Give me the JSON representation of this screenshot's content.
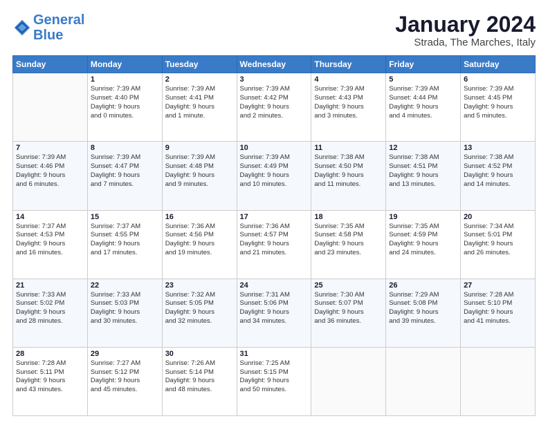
{
  "header": {
    "logo_line1": "General",
    "logo_line2": "Blue",
    "month": "January 2024",
    "location": "Strada, The Marches, Italy"
  },
  "weekdays": [
    "Sunday",
    "Monday",
    "Tuesday",
    "Wednesday",
    "Thursday",
    "Friday",
    "Saturday"
  ],
  "weeks": [
    [
      {
        "day": "",
        "info": ""
      },
      {
        "day": "1",
        "info": "Sunrise: 7:39 AM\nSunset: 4:40 PM\nDaylight: 9 hours\nand 0 minutes."
      },
      {
        "day": "2",
        "info": "Sunrise: 7:39 AM\nSunset: 4:41 PM\nDaylight: 9 hours\nand 1 minute."
      },
      {
        "day": "3",
        "info": "Sunrise: 7:39 AM\nSunset: 4:42 PM\nDaylight: 9 hours\nand 2 minutes."
      },
      {
        "day": "4",
        "info": "Sunrise: 7:39 AM\nSunset: 4:43 PM\nDaylight: 9 hours\nand 3 minutes."
      },
      {
        "day": "5",
        "info": "Sunrise: 7:39 AM\nSunset: 4:44 PM\nDaylight: 9 hours\nand 4 minutes."
      },
      {
        "day": "6",
        "info": "Sunrise: 7:39 AM\nSunset: 4:45 PM\nDaylight: 9 hours\nand 5 minutes."
      }
    ],
    [
      {
        "day": "7",
        "info": "Sunrise: 7:39 AM\nSunset: 4:46 PM\nDaylight: 9 hours\nand 6 minutes."
      },
      {
        "day": "8",
        "info": "Sunrise: 7:39 AM\nSunset: 4:47 PM\nDaylight: 9 hours\nand 7 minutes."
      },
      {
        "day": "9",
        "info": "Sunrise: 7:39 AM\nSunset: 4:48 PM\nDaylight: 9 hours\nand 9 minutes."
      },
      {
        "day": "10",
        "info": "Sunrise: 7:39 AM\nSunset: 4:49 PM\nDaylight: 9 hours\nand 10 minutes."
      },
      {
        "day": "11",
        "info": "Sunrise: 7:38 AM\nSunset: 4:50 PM\nDaylight: 9 hours\nand 11 minutes."
      },
      {
        "day": "12",
        "info": "Sunrise: 7:38 AM\nSunset: 4:51 PM\nDaylight: 9 hours\nand 13 minutes."
      },
      {
        "day": "13",
        "info": "Sunrise: 7:38 AM\nSunset: 4:52 PM\nDaylight: 9 hours\nand 14 minutes."
      }
    ],
    [
      {
        "day": "14",
        "info": "Sunrise: 7:37 AM\nSunset: 4:53 PM\nDaylight: 9 hours\nand 16 minutes."
      },
      {
        "day": "15",
        "info": "Sunrise: 7:37 AM\nSunset: 4:55 PM\nDaylight: 9 hours\nand 17 minutes."
      },
      {
        "day": "16",
        "info": "Sunrise: 7:36 AM\nSunset: 4:56 PM\nDaylight: 9 hours\nand 19 minutes."
      },
      {
        "day": "17",
        "info": "Sunrise: 7:36 AM\nSunset: 4:57 PM\nDaylight: 9 hours\nand 21 minutes."
      },
      {
        "day": "18",
        "info": "Sunrise: 7:35 AM\nSunset: 4:58 PM\nDaylight: 9 hours\nand 23 minutes."
      },
      {
        "day": "19",
        "info": "Sunrise: 7:35 AM\nSunset: 4:59 PM\nDaylight: 9 hours\nand 24 minutes."
      },
      {
        "day": "20",
        "info": "Sunrise: 7:34 AM\nSunset: 5:01 PM\nDaylight: 9 hours\nand 26 minutes."
      }
    ],
    [
      {
        "day": "21",
        "info": "Sunrise: 7:33 AM\nSunset: 5:02 PM\nDaylight: 9 hours\nand 28 minutes."
      },
      {
        "day": "22",
        "info": "Sunrise: 7:33 AM\nSunset: 5:03 PM\nDaylight: 9 hours\nand 30 minutes."
      },
      {
        "day": "23",
        "info": "Sunrise: 7:32 AM\nSunset: 5:05 PM\nDaylight: 9 hours\nand 32 minutes."
      },
      {
        "day": "24",
        "info": "Sunrise: 7:31 AM\nSunset: 5:06 PM\nDaylight: 9 hours\nand 34 minutes."
      },
      {
        "day": "25",
        "info": "Sunrise: 7:30 AM\nSunset: 5:07 PM\nDaylight: 9 hours\nand 36 minutes."
      },
      {
        "day": "26",
        "info": "Sunrise: 7:29 AM\nSunset: 5:08 PM\nDaylight: 9 hours\nand 39 minutes."
      },
      {
        "day": "27",
        "info": "Sunrise: 7:28 AM\nSunset: 5:10 PM\nDaylight: 9 hours\nand 41 minutes."
      }
    ],
    [
      {
        "day": "28",
        "info": "Sunrise: 7:28 AM\nSunset: 5:11 PM\nDaylight: 9 hours\nand 43 minutes."
      },
      {
        "day": "29",
        "info": "Sunrise: 7:27 AM\nSunset: 5:12 PM\nDaylight: 9 hours\nand 45 minutes."
      },
      {
        "day": "30",
        "info": "Sunrise: 7:26 AM\nSunset: 5:14 PM\nDaylight: 9 hours\nand 48 minutes."
      },
      {
        "day": "31",
        "info": "Sunrise: 7:25 AM\nSunset: 5:15 PM\nDaylight: 9 hours\nand 50 minutes."
      },
      {
        "day": "",
        "info": ""
      },
      {
        "day": "",
        "info": ""
      },
      {
        "day": "",
        "info": ""
      }
    ]
  ]
}
